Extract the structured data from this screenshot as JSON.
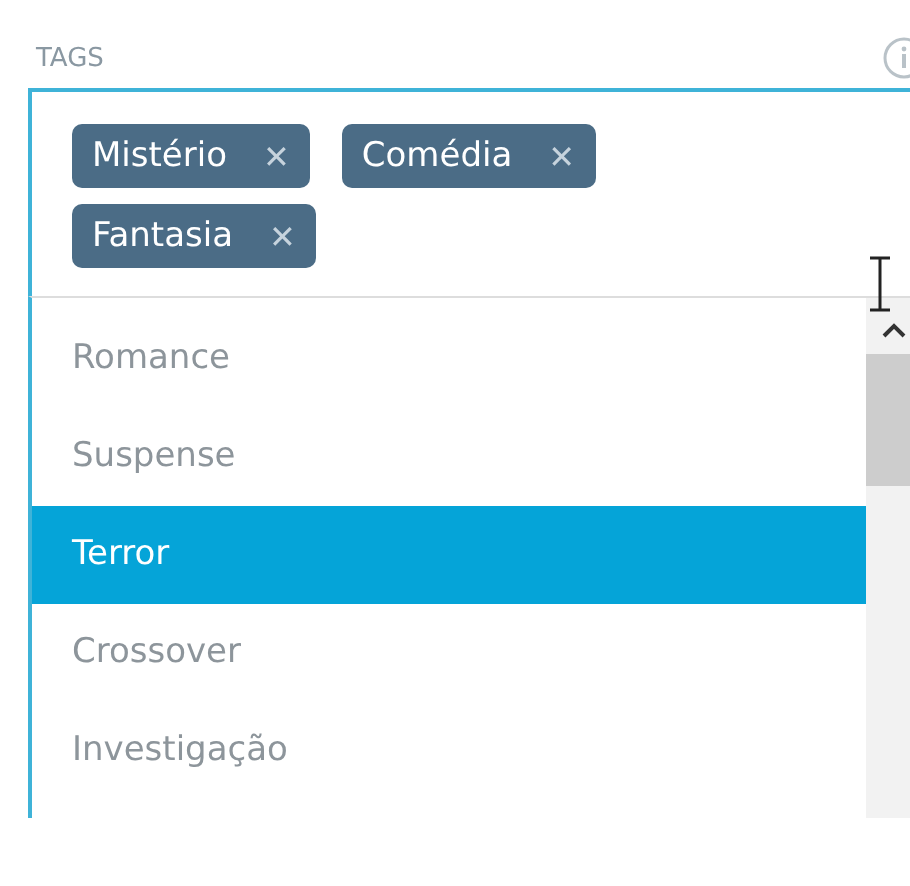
{
  "field": {
    "label": "TAGS",
    "tags": [
      {
        "label": "Mistério",
        "remove": "✕"
      },
      {
        "label": "Comédia",
        "remove": "✕"
      },
      {
        "label": "Fantasia",
        "remove": "✕"
      }
    ]
  },
  "dropdown": {
    "options": [
      {
        "label": "Romance",
        "selected": false
      },
      {
        "label": "Suspense",
        "selected": false
      },
      {
        "label": "Terror",
        "selected": true
      },
      {
        "label": "Crossover",
        "selected": false
      },
      {
        "label": "Investigação",
        "selected": false
      }
    ]
  }
}
